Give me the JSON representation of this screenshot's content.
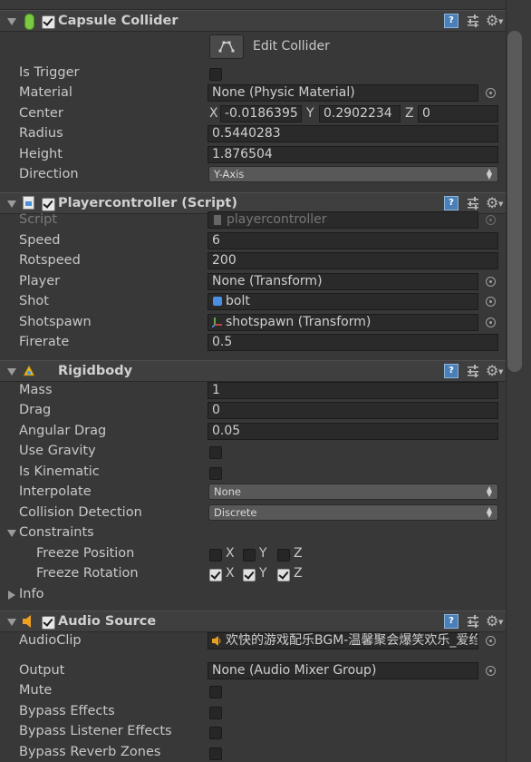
{
  "capsule": {
    "title": "Capsule Collider",
    "edit_label": "Edit Collider",
    "rows": {
      "is_trigger": "Is Trigger",
      "material": "Material",
      "material_value": "None (Physic Material)",
      "center": "Center",
      "center_x": "-0.0186395",
      "center_y": "0.2902234",
      "center_z": "0",
      "radius": "Radius",
      "radius_value": "0.5440283",
      "height": "Height",
      "height_value": "1.876504",
      "direction": "Direction",
      "direction_value": "Y-Axis"
    },
    "is_trigger_checked": false
  },
  "player": {
    "title": "Playercontroller (Script)",
    "script_label": "Script",
    "script_value": "playercontroller",
    "speed_label": "Speed",
    "speed_value": "6",
    "rotspeed_label": "Rotspeed",
    "rotspeed_value": "200",
    "player_label": "Player",
    "player_value": "None (Transform)",
    "shot_label": "Shot",
    "shot_value": "bolt",
    "shotspawn_label": "Shotspawn",
    "shotspawn_value": "shotspawn (Transform)",
    "firerate_label": "Firerate",
    "firerate_value": "0.5"
  },
  "rigidbody": {
    "title": "Rigidbody",
    "mass_label": "Mass",
    "mass_value": "1",
    "drag_label": "Drag",
    "drag_value": "0",
    "angular_label": "Angular Drag",
    "angular_value": "0.05",
    "gravity_label": "Use Gravity",
    "kinematic_label": "Is Kinematic",
    "interpolate_label": "Interpolate",
    "interpolate_value": "None",
    "collision_label": "Collision Detection",
    "collision_value": "Discrete",
    "constraints_label": "Constraints",
    "freeze_pos_label": "Freeze Position",
    "freeze_rot_label": "Freeze Rotation",
    "info_label": "Info",
    "axis_x": "X",
    "axis_y": "Y",
    "axis_z": "Z",
    "use_gravity": false,
    "is_kinematic": false,
    "freeze_position": [
      false,
      false,
      false
    ],
    "freeze_rotation": [
      true,
      true,
      true
    ]
  },
  "audio": {
    "title": "Audio Source",
    "clip_label": "AudioClip",
    "clip_value": "欢快的游戏配乐BGM-温馨聚会爆笑欢乐_爱绉",
    "output_label": "Output",
    "output_value": "None (Audio Mixer Group)",
    "mute_label": "Mute",
    "bypass_effects_label": "Bypass Effects",
    "bypass_listener_label": "Bypass Listener Effects",
    "bypass_reverb_label": "Bypass Reverb Zones"
  },
  "icons": {
    "help": "help-book-icon",
    "presets": "presets-sliders-icon",
    "settings": "gear-icon"
  }
}
